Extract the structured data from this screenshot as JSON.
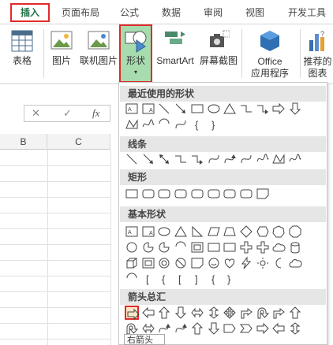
{
  "tabs": [
    "插入",
    "页面布局",
    "公式",
    "数据",
    "审阅",
    "视图",
    "开发工具"
  ],
  "ribbon": {
    "table": "表格",
    "picture": "图片",
    "online_picture": "联机图片",
    "shapes": "形状",
    "smartart": "SmartArt",
    "screenshot": "屏幕截图",
    "office_apps_line1": "Office",
    "office_apps_line2": "应用程序",
    "recommended_line1": "推荐的",
    "recommended_line2": "图表"
  },
  "formula_bar": {
    "cancel": "✕",
    "enter": "✓",
    "fx": "fx"
  },
  "columns": [
    "B",
    "C"
  ],
  "gallery": {
    "sections": [
      "最近使用的形状",
      "线条",
      "矩形",
      "基本形状",
      "箭头总汇"
    ],
    "tooltip": "右箭头"
  },
  "colors": {
    "accent": "#217346",
    "highlight": "#e02a2a",
    "shape_btn_bg": "#a7dcae"
  }
}
